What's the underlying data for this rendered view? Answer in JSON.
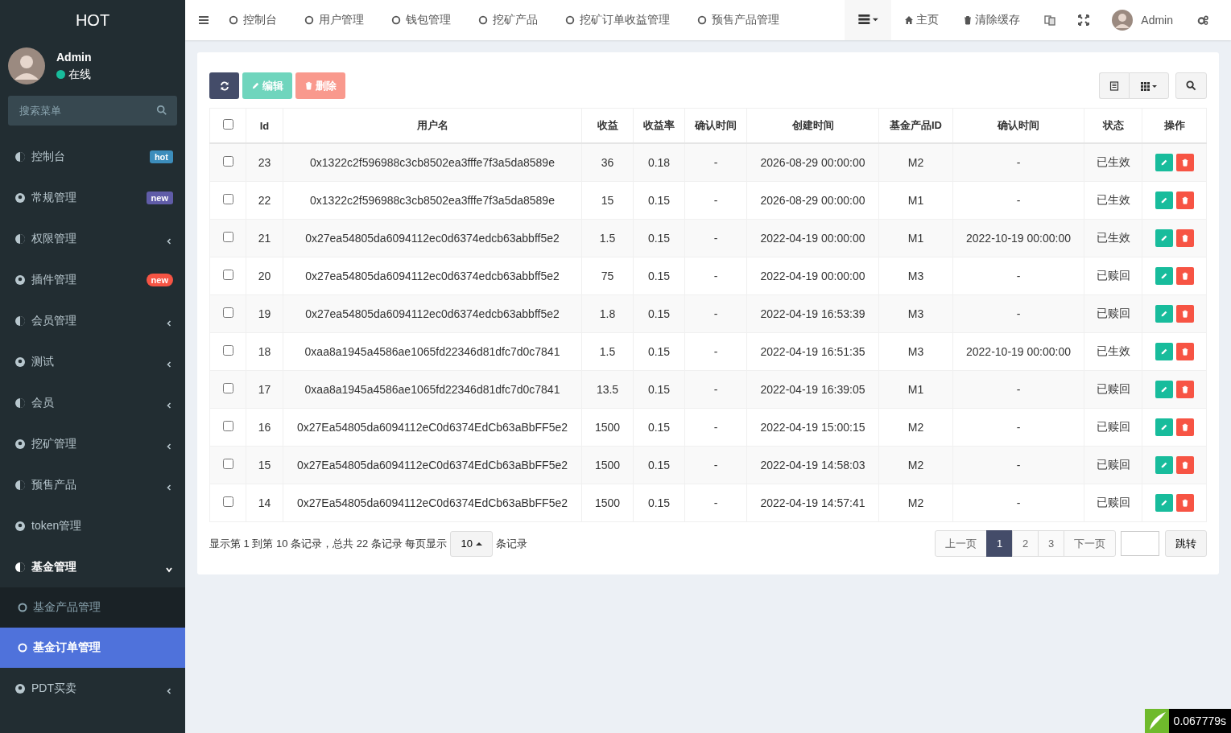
{
  "sidebar": {
    "logo": "HOT",
    "user": {
      "name": "Admin",
      "status": "在线"
    },
    "search": {
      "placeholder": "搜索菜单"
    },
    "items": [
      {
        "label": "控制台",
        "badge": {
          "text": "hot",
          "color": "#3c8dbc"
        }
      },
      {
        "label": "常规管理",
        "badge": {
          "text": "new",
          "color": "#605ca8"
        }
      },
      {
        "label": "权限管理",
        "expanded": false
      },
      {
        "label": "插件管理",
        "badge": {
          "text": "new",
          "color": "#f75444"
        }
      },
      {
        "label": "会员管理",
        "expanded": false
      },
      {
        "label": "测试",
        "expanded": false
      },
      {
        "label": "会员",
        "expanded": false
      },
      {
        "label": "挖矿管理",
        "expanded": false
      },
      {
        "label": "预售产品",
        "expanded": false
      },
      {
        "label": "token管理"
      },
      {
        "label": "基金管理",
        "expanded": true,
        "children": [
          {
            "label": "基金产品管理",
            "selected": false
          },
          {
            "label": "基金订单管理",
            "selected": true
          }
        ]
      },
      {
        "label": "PDT买卖",
        "expanded": false
      }
    ]
  },
  "topbar": {
    "tabs": [
      "控制台",
      "用户管理",
      "钱包管理",
      "挖矿产品",
      "挖矿订单收益管理",
      "预售产品管理"
    ],
    "home": "主页",
    "clear_cache": "清除缓存",
    "user": "Admin"
  },
  "toolbar": {
    "edit": "编辑",
    "delete": "删除"
  },
  "table": {
    "header_checked": false,
    "columns": [
      "Id",
      "用户名",
      "收益",
      "收益率",
      "确认时间",
      "创建时间",
      "基金产品ID",
      "确认时间",
      "状态",
      "操作"
    ],
    "rows": [
      {
        "checked": false,
        "cells": [
          "23",
          "0x1322c2f596988c3cb8502ea3fffe7f3a5da8589e",
          "36",
          "0.18",
          "-",
          "2026-08-29 00:00:00",
          "M2",
          "-",
          "已生效"
        ]
      },
      {
        "checked": false,
        "cells": [
          "22",
          "0x1322c2f596988c3cb8502ea3fffe7f3a5da8589e",
          "15",
          "0.15",
          "-",
          "2026-08-29 00:00:00",
          "M1",
          "-",
          "已生效"
        ]
      },
      {
        "checked": false,
        "cells": [
          "21",
          "0x27ea54805da6094112ec0d6374edcb63abbff5e2",
          "1.5",
          "0.15",
          "-",
          "2022-04-19 00:00:00",
          "M1",
          "2022-10-19 00:00:00",
          "已生效"
        ]
      },
      {
        "checked": false,
        "cells": [
          "20",
          "0x27ea54805da6094112ec0d6374edcb63abbff5e2",
          "75",
          "0.15",
          "-",
          "2022-04-19 00:00:00",
          "M3",
          "-",
          "已赎回"
        ]
      },
      {
        "checked": false,
        "cells": [
          "19",
          "0x27ea54805da6094112ec0d6374edcb63abbff5e2",
          "1.8",
          "0.15",
          "-",
          "2022-04-19 16:53:39",
          "M3",
          "-",
          "已赎回"
        ]
      },
      {
        "checked": false,
        "cells": [
          "18",
          "0xaa8a1945a4586ae1065fd22346d81dfc7d0c7841",
          "1.5",
          "0.15",
          "-",
          "2022-04-19 16:51:35",
          "M3",
          "2022-10-19 00:00:00",
          "已生效"
        ]
      },
      {
        "checked": false,
        "cells": [
          "17",
          "0xaa8a1945a4586ae1065fd22346d81dfc7d0c7841",
          "13.5",
          "0.15",
          "-",
          "2022-04-19 16:39:05",
          "M1",
          "-",
          "已赎回"
        ]
      },
      {
        "checked": false,
        "cells": [
          "16",
          "0x27Ea54805da6094112eC0d6374EdCb63aBbFF5e2",
          "1500",
          "0.15",
          "-",
          "2022-04-19 15:00:15",
          "M2",
          "-",
          "已赎回"
        ]
      },
      {
        "checked": false,
        "cells": [
          "15",
          "0x27Ea54805da6094112eC0d6374EdCb63aBbFF5e2",
          "1500",
          "0.15",
          "-",
          "2022-04-19 14:58:03",
          "M2",
          "-",
          "已赎回"
        ]
      },
      {
        "checked": false,
        "cells": [
          "14",
          "0x27Ea54805da6094112eC0d6374EdCb63aBbFF5e2",
          "1500",
          "0.15",
          "-",
          "2022-04-19 14:57:41",
          "M2",
          "-",
          "已赎回"
        ]
      }
    ]
  },
  "footer": {
    "summary": "显示第 1 到第 10 条记录，总共 22 条记录 每页显示",
    "page_size": "10",
    "suffix": "条记录",
    "prev": "上一页",
    "pages": [
      {
        "label": "1",
        "selected": true
      },
      {
        "label": "2",
        "selected": false
      },
      {
        "label": "3",
        "selected": false
      }
    ],
    "next": "下一页",
    "jump": "跳转"
  },
  "debug_time": "0.067779s"
}
